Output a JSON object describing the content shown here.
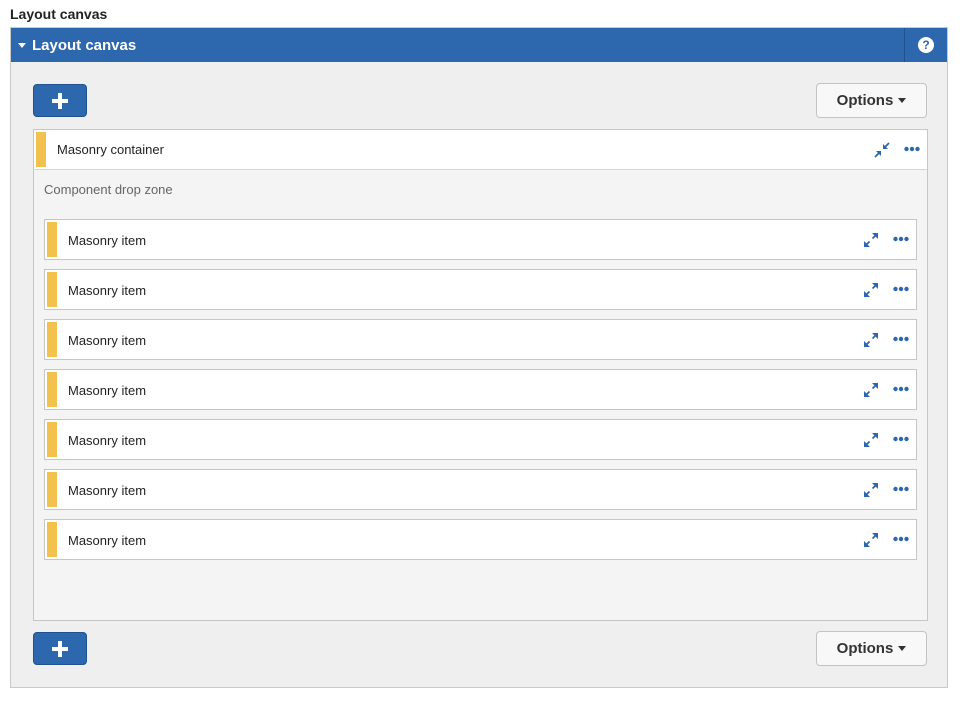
{
  "page_label": "Layout canvas",
  "panel": {
    "title": "Layout canvas",
    "help": "?"
  },
  "toolbar_top": {
    "options_label": "Options"
  },
  "toolbar_bottom": {
    "options_label": "Options"
  },
  "container": {
    "title": "Masonry container",
    "drop_zone": "Component drop zone",
    "items": [
      {
        "label": "Masonry item"
      },
      {
        "label": "Masonry item"
      },
      {
        "label": "Masonry item"
      },
      {
        "label": "Masonry item"
      },
      {
        "label": "Masonry item"
      },
      {
        "label": "Masonry item"
      },
      {
        "label": "Masonry item"
      }
    ]
  },
  "icons": {
    "collapse": "collapse-arrows-icon",
    "expand": "expand-arrows-icon",
    "more": "more-dots-icon",
    "add": "plus-icon",
    "help": "help-circle-icon"
  },
  "colors": {
    "header_blue": "#2d67ad",
    "accent_yellow": "#f2c14e",
    "icon_blue": "#2d67ad"
  }
}
